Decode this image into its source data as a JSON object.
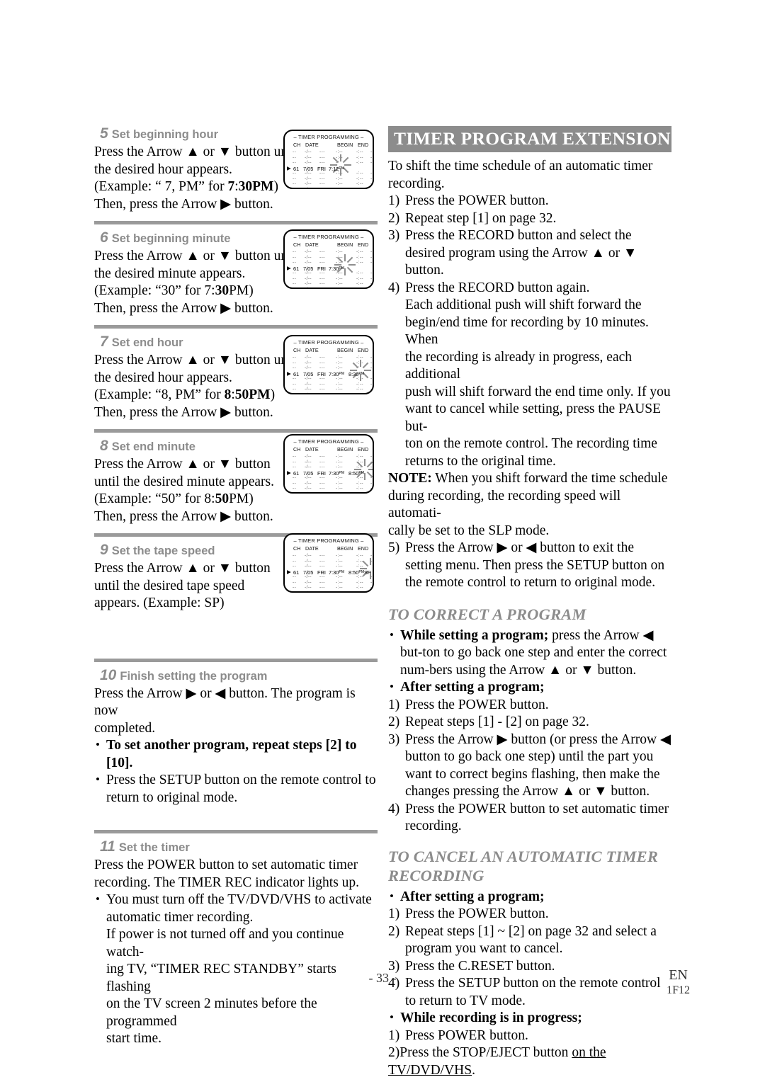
{
  "page": {
    "number": "- 33 -",
    "lang_code": "EN",
    "doc_code": "1F12"
  },
  "colors": {
    "banner_bg": "#8c8c8c",
    "heading_gray": "#8c8c8c",
    "rule_gray": "#9a9a9a"
  },
  "left_column": {
    "steps": [
      {
        "number": "5",
        "title": "Set beginning hour",
        "lines": [
          "Press the Arrow ▲ or ▼ button until",
          "the desired hour appears.",
          "(Example: “ 7, PM” for 7:30PM)",
          "Then, press the Arrow ▶ button."
        ],
        "screen": {
          "title": "– TIMER PROGRAMMING –",
          "columns": [
            "CH",
            "DATE",
            "BEGIN",
            "END"
          ],
          "row": {
            "pointer": "▶",
            "ch": "61",
            "date": "7/05",
            "day": "FRI",
            "begin": "7:12",
            "begin_ampm": "PM",
            "end": "",
            "end_ampm": "",
            "speed": ""
          },
          "flash_on": "begin-hour"
        }
      },
      {
        "number": "6",
        "title": "Set beginning minute",
        "lines": [
          "Press the Arrow ▲ or ▼ button until",
          "the desired minute appears.",
          "(Example: “30” for 7:30PM)",
          "Then, press the Arrow ▶ button."
        ],
        "screen": {
          "title": "– TIMER PROGRAMMING –",
          "columns": [
            "CH",
            "DATE",
            "BEGIN",
            "END"
          ],
          "row": {
            "pointer": "▶",
            "ch": "61",
            "date": "7/05",
            "day": "FRI",
            "begin": "7:30",
            "begin_ampm": "PM",
            "end": "",
            "end_ampm": "",
            "speed": ""
          },
          "flash_on": "begin-minute"
        }
      },
      {
        "number": "7",
        "title": "Set end hour",
        "lines": [
          "Press the Arrow ▲ or ▼ button until",
          "the desired hour appears.",
          "(Example: “8, PM” for 8:50PM)",
          "Then, press the Arrow ▶ button."
        ],
        "screen": {
          "title": "– TIMER PROGRAMMING –",
          "columns": [
            "CH",
            "DATE",
            "BEGIN",
            "END"
          ],
          "row": {
            "pointer": "▶",
            "ch": "61",
            "date": "7/05",
            "day": "FRI",
            "begin": "7:30",
            "begin_ampm": "PM",
            "end": "8:30",
            "end_ampm": "PM",
            "speed": ""
          },
          "flash_on": "end-hour"
        }
      },
      {
        "number": "8",
        "title": "Set end minute",
        "lines": [
          "Press the Arrow ▲ or ▼ button",
          "until the desired minute appears.",
          "(Example: “50” for 8:50PM)",
          "Then, press the Arrow ▶ button."
        ],
        "screen": {
          "title": "– TIMER PROGRAMMING –",
          "columns": [
            "CH",
            "DATE",
            "BEGIN",
            "END"
          ],
          "row": {
            "pointer": "▶",
            "ch": "61",
            "date": "7/05",
            "day": "FRI",
            "begin": "7:30",
            "begin_ampm": "PM",
            "end": "8:50",
            "end_ampm": "PM",
            "speed": ""
          },
          "flash_on": "end-minute"
        }
      },
      {
        "number": "9",
        "title": "Set the tape speed",
        "lines": [
          "Press the Arrow ▲ or ▼ button",
          "until the desired tape speed",
          "appears. (Example: SP)"
        ],
        "screen": {
          "title": "– TIMER PROGRAMMING –",
          "columns": [
            "CH",
            "DATE",
            "BEGIN",
            "END"
          ],
          "row": {
            "pointer": "▶",
            "ch": "61",
            "date": "7/05",
            "day": "FRI",
            "begin": "7:30",
            "begin_ampm": "PM",
            "end": "8:50",
            "end_ampm": "PM",
            "speed": "SP"
          },
          "flash_on": "speed"
        }
      },
      {
        "number": "10",
        "title": "Finish setting the program",
        "lines": [
          "Press the Arrow ▶ or ◀ button. The program is now",
          "completed."
        ],
        "bullets": [
          {
            "bold": true,
            "text": "To set another program, repeat steps [2] to [10]."
          },
          {
            "bold": false,
            "text": "Press the SETUP button on the remote control to return to original mode."
          }
        ]
      },
      {
        "number": "11",
        "title": "Set the timer",
        "lines": [
          "Press the POWER button to set automatic timer",
          "recording. The TIMER REC indicator lights up."
        ],
        "bullets": [
          {
            "bold": false,
            "text": "You must turn off the TV/DVD/VHS to activate automatic timer recording."
          }
        ],
        "tail": [
          "If power is not turned off and you continue watch-",
          "ing TV, “TIMER REC STANDBY” starts flashing",
          "on the TV screen 2 minutes before the programmed",
          "start time."
        ]
      }
    ]
  },
  "right_column": {
    "banner_title": "TIMER PROGRAM EXTENSION",
    "intro": [
      "To shift the time schedule of an automatic timer",
      "recording."
    ],
    "steps": [
      {
        "n": "1)",
        "text": "Press the POWER button."
      },
      {
        "n": "2)",
        "text": "Repeat step [1] on page 32."
      },
      {
        "n": "3)",
        "text": "Press the RECORD button and select the desired program using the Arrow ▲ or ▼ button."
      },
      {
        "n": "4)",
        "text": "Press the RECORD button again."
      }
    ],
    "paragraph": [
      "Each additional push will shift forward the",
      "begin/end time for recording by 10 minutes. When",
      "the recording is already in progress, each additional",
      "push will shift forward the end time only. If you",
      "want to cancel while setting, press the PAUSE but-",
      "ton on the remote control. The recording time",
      "returns to the original time."
    ],
    "note_label": "NOTE:",
    "note_text": [
      " When you shift forward the time schedule",
      "during recording, the recording speed will automati-",
      "cally be set to the SLP mode."
    ],
    "step5": {
      "n": "5)",
      "text": "Press the Arrow ▶ or ◀ button to exit the setting menu. Then press the SETUP button on the remote control to return to original mode."
    },
    "correct_heading": "TO CORRECT A PROGRAM",
    "correct_bullets": [
      {
        "lead": "While setting a program;",
        "rest": " press the Arrow ◀ but-ton to go back one step and enter the correct num-bers using the Arrow ▲ or ▼ button."
      },
      {
        "lead": "After setting a program;",
        "rest": ""
      }
    ],
    "correct_steps": [
      {
        "n": "1)",
        "text": "Press the POWER button."
      },
      {
        "n": "2)",
        "text": "Repeat steps [1] - [2] on page 32."
      },
      {
        "n": "3)",
        "text": "Press the Arrow ▶ button (or press the Arrow ◀ button to go back one step) until the part you want to correct begins flashing, then make the changes pressing the Arrow ▲ or ▼ button."
      },
      {
        "n": "4)",
        "text": "Press the POWER button to set automatic timer recording."
      }
    ],
    "cancel_heading": "TO CANCEL AN AUTOMATIC TIMER RECORDING",
    "cancel_bullet1": "After setting a program;",
    "cancel_steps1": [
      {
        "n": "1)",
        "text": "Press the POWER button."
      },
      {
        "n": "2)",
        "text": "Repeat steps [1] ~ [2] on page 32 and select a program you want to cancel."
      },
      {
        "n": "3)",
        "text": "Press the C.RESET button."
      },
      {
        "n": "4)",
        "text": "Press the SETUP button on the remote control to return to TV mode."
      }
    ],
    "cancel_bullet2": "While recording is in progress;",
    "cancel_steps2": [
      {
        "n": "1)",
        "text": "Press POWER button."
      },
      {
        "n": "2)",
        "text": "Press the STOP/EJECT button on the TV/DVD/VHS."
      }
    ]
  }
}
